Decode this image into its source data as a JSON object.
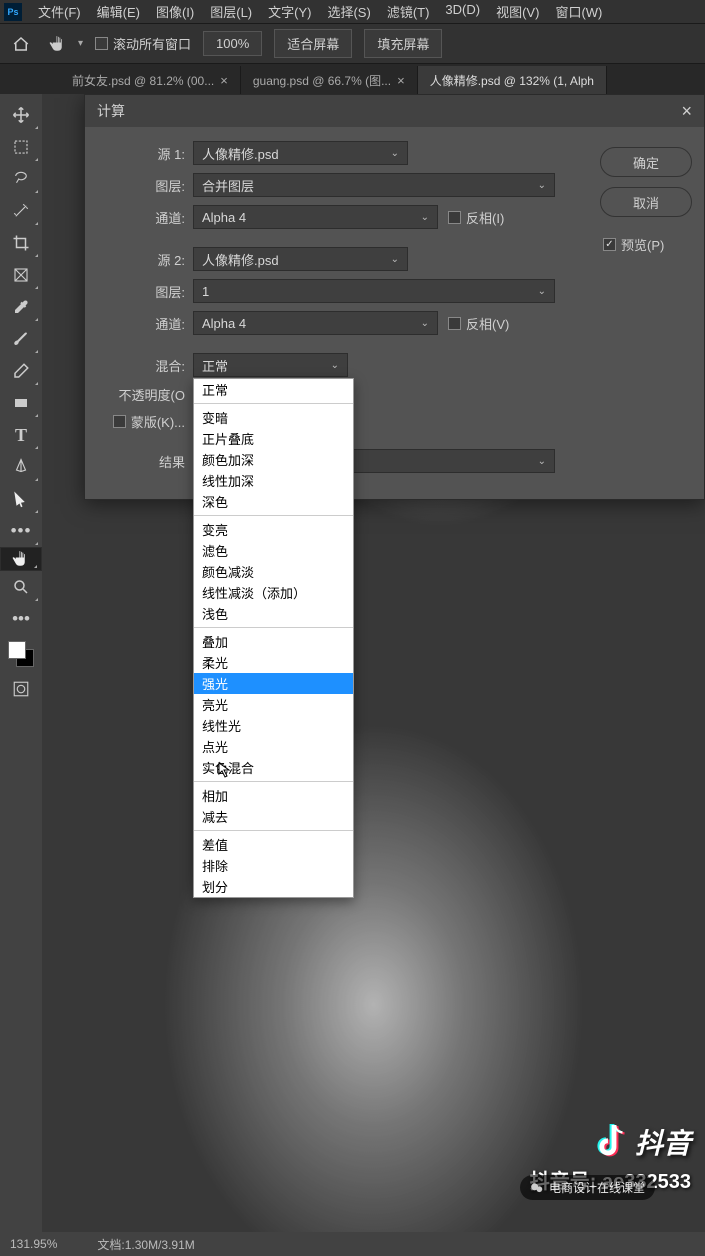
{
  "menubar": [
    "文件(F)",
    "编辑(E)",
    "图像(I)",
    "图层(L)",
    "文字(Y)",
    "选择(S)",
    "滤镜(T)",
    "3D(D)",
    "视图(V)",
    "窗口(W)"
  ],
  "options": {
    "scroll_all": "滚动所有窗口",
    "zoom_pct": "100%",
    "fit": "适合屏幕",
    "fill": "填充屏幕"
  },
  "tabs": [
    {
      "label": "前女友.psd @ 81.2% (00...",
      "active": false
    },
    {
      "label": "guang.psd @ 66.7% (图...",
      "active": false
    },
    {
      "label": "人像精修.psd @ 132% (1, Alph",
      "active": true
    }
  ],
  "dialog": {
    "title": "计算",
    "ok": "确定",
    "cancel": "取消",
    "preview": "预览(P)",
    "source1_label": "源 1:",
    "source1_value": "人像精修.psd",
    "layer_label": "图层:",
    "layer1_value": "合并图层",
    "channel_label": "通道:",
    "channel1_value": "Alpha 4",
    "invert1": "反相(I)",
    "source2_label": "源 2:",
    "source2_value": "人像精修.psd",
    "layer2_value": "1",
    "channel2_value": "Alpha 4",
    "invert2": "反相(V)",
    "blend_label": "混合:",
    "blend_value": "正常",
    "opacity_label": "不透明度(O",
    "mask_label": "蒙版(K)...",
    "result_label": "结果"
  },
  "blend_groups": [
    [
      "正常"
    ],
    [
      "变暗",
      "正片叠底",
      "颜色加深",
      "线性加深",
      "深色"
    ],
    [
      "变亮",
      "滤色",
      "颜色减淡",
      "线性减淡（添加）",
      "浅色"
    ],
    [
      "叠加",
      "柔光",
      "强光",
      "亮光",
      "线性光",
      "点光",
      "实色混合"
    ],
    [
      "相加",
      "减去"
    ],
    [
      "差值",
      "排除",
      "划分"
    ]
  ],
  "blend_highlight": "强光",
  "status": {
    "zoom": "131.95%",
    "doc": "文档:1.30M/3.91M"
  },
  "watermark": {
    "brand": "抖音",
    "id_prefix": "抖音号: ",
    "id": "ae332533",
    "wechat": "电商设计在线课堂"
  }
}
